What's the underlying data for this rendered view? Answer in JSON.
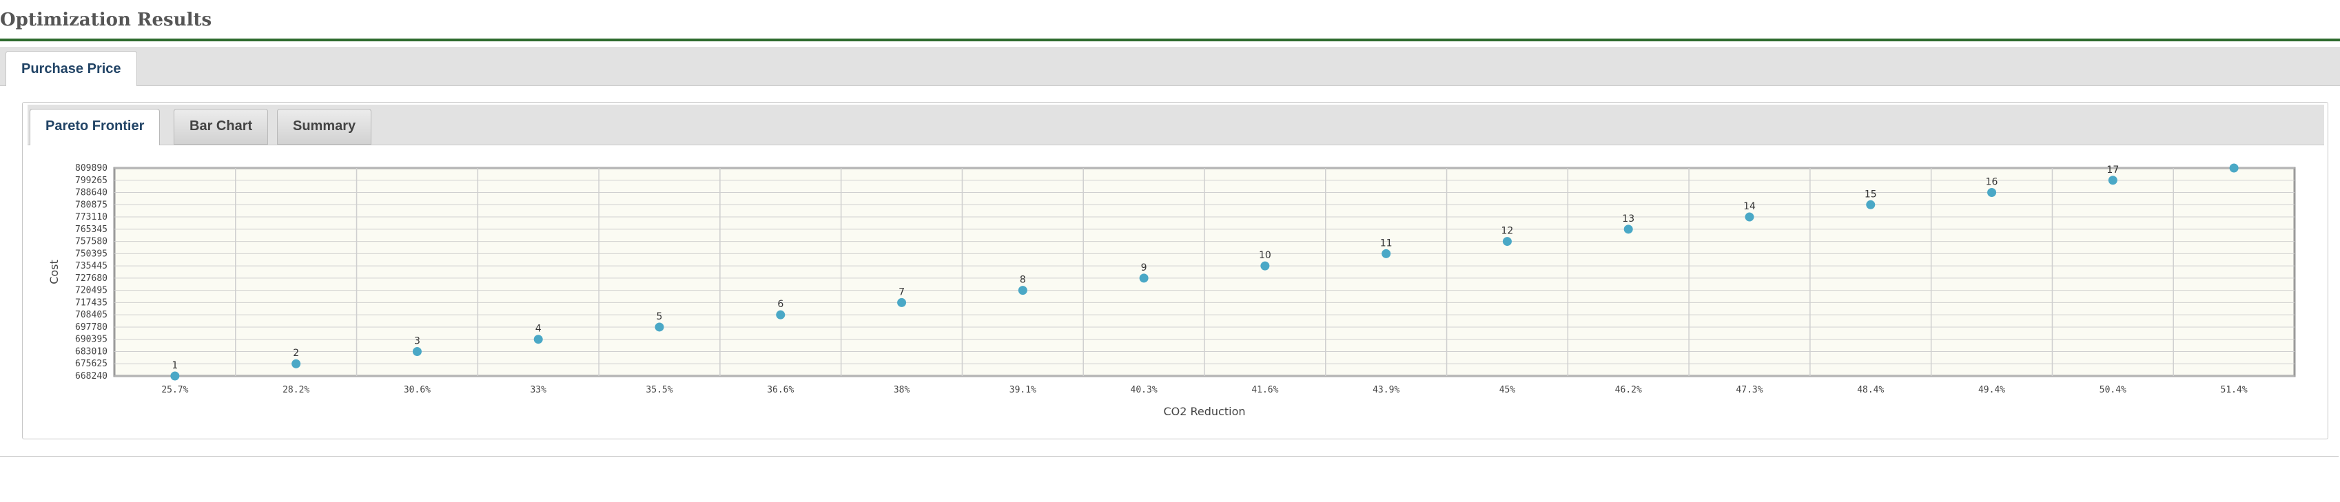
{
  "page": {
    "title": "Optimization Results"
  },
  "outer_tabs": [
    {
      "label": "Purchase Price",
      "active": true
    }
  ],
  "inner_tabs": [
    {
      "label": "Pareto Frontier",
      "active": true
    },
    {
      "label": "Bar Chart",
      "active": false
    },
    {
      "label": "Summary",
      "active": false
    }
  ],
  "colors": {
    "title_rule": "#2e6b2e",
    "point": "#4aa8c6",
    "plot_bg": "#fbfbf3"
  },
  "chart_data": {
    "type": "scatter",
    "xlabel": "CO2 Reduction",
    "ylabel": "Cost",
    "x_ticks": [
      "25.7%",
      "28.2%",
      "30.6%",
      "33%",
      "35.5%",
      "36.6%",
      "38%",
      "39.1%",
      "40.3%",
      "41.6%",
      "43.9%",
      "45%",
      "46.2%",
      "47.3%",
      "48.4%",
      "49.4%",
      "50.4%",
      "51.4%"
    ],
    "y_ticks": [
      "809890",
      "799265",
      "788640",
      "780875",
      "773110",
      "765345",
      "757580",
      "750395",
      "735445",
      "727680",
      "720495",
      "717435",
      "708405",
      "697780",
      "690395",
      "683010",
      "675625",
      "668240"
    ],
    "points": [
      {
        "label": "1",
        "x": "25.7%",
        "y": 668240
      },
      {
        "label": "2",
        "x": "28.2%",
        "y": 675625
      },
      {
        "label": "3",
        "x": "30.6%",
        "y": 683010
      },
      {
        "label": "4",
        "x": "33%",
        "y": 690395
      },
      {
        "label": "5",
        "x": "35.5%",
        "y": 697780
      },
      {
        "label": "6",
        "x": "36.6%",
        "y": 708405
      },
      {
        "label": "7",
        "x": "38%",
        "y": 717435
      },
      {
        "label": "8",
        "x": "39.1%",
        "y": 720495
      },
      {
        "label": "9",
        "x": "40.3%",
        "y": 727680
      },
      {
        "label": "10",
        "x": "41.6%",
        "y": 735445
      },
      {
        "label": "11",
        "x": "43.9%",
        "y": 750395
      },
      {
        "label": "12",
        "x": "45%",
        "y": 757580
      },
      {
        "label": "13",
        "x": "46.2%",
        "y": 765345
      },
      {
        "label": "14",
        "x": "47.3%",
        "y": 773110
      },
      {
        "label": "15",
        "x": "48.4%",
        "y": 780875
      },
      {
        "label": "16",
        "x": "49.4%",
        "y": 788640
      },
      {
        "label": "17",
        "x": "50.4%",
        "y": 799265
      },
      {
        "label": "",
        "x": "51.4%",
        "y": 809890
      }
    ],
    "grid": true,
    "legend": "none"
  }
}
